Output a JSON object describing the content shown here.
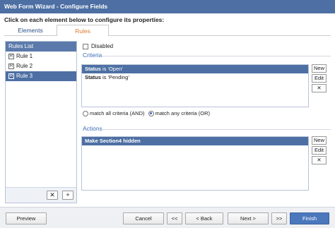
{
  "window": {
    "title": "Web Form Wizard - Configure Fields"
  },
  "instruction": "Click on each element below to configure its properties:",
  "tabs": [
    {
      "label": "Elements",
      "active": false
    },
    {
      "label": "Rules",
      "active": true
    }
  ],
  "rules_list": {
    "header": "Rules List",
    "items": [
      {
        "label": "Rule 1",
        "selected": false
      },
      {
        "label": "Rule 2",
        "selected": false
      },
      {
        "label": "Rule 3",
        "selected": true
      }
    ],
    "delete_glyph": "✕",
    "add_glyph": "+"
  },
  "disabled": {
    "label": "Disabled",
    "checked": false
  },
  "criteria": {
    "label": "Criteria",
    "rows": [
      {
        "field": "Status",
        "op": " is ",
        "value": "'Open'",
        "selected": true
      },
      {
        "field": "Status",
        "op": " is ",
        "value": "'Pending'",
        "selected": false
      }
    ],
    "buttons": {
      "new": "New",
      "edit": "Edit",
      "delete": "✕"
    }
  },
  "match": {
    "all_label": "match all criteria (AND)",
    "any_label": "match any criteria (OR)",
    "selected": "any"
  },
  "actions": {
    "label": "Actions",
    "rows": [
      {
        "text": "Make Section4 hidden",
        "selected": true
      }
    ],
    "buttons": {
      "new": "New",
      "edit": "Edit",
      "delete": "✕"
    }
  },
  "footer": {
    "preview": "Preview",
    "cancel": "Cancel",
    "first": "<<",
    "back": "< Back",
    "next": "Next >",
    "last": ">>",
    "finish": "Finish"
  },
  "colors": {
    "titlebar": "#4d6fa3",
    "selection": "#4d6fa3",
    "active_tab": "#e07a2a",
    "section_label": "#3b6cb3",
    "finish_button": "#4b78bd"
  }
}
